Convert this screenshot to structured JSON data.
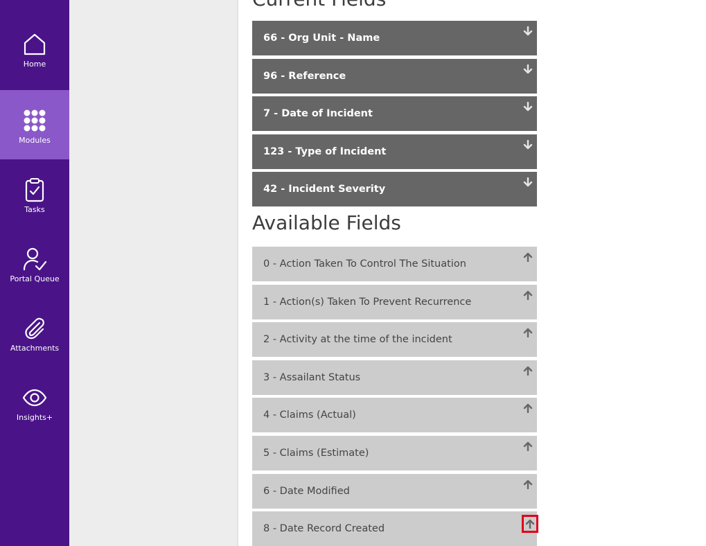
{
  "sidebar": {
    "items": [
      {
        "label": "Home",
        "icon": "home-icon",
        "active": false
      },
      {
        "label": "Modules",
        "icon": "grid-dots-icon",
        "active": true
      },
      {
        "label": "Tasks",
        "icon": "clipboard-check-icon",
        "active": false
      },
      {
        "label": "Portal Queue",
        "icon": "user-check-icon",
        "active": false
      },
      {
        "label": "Attachments",
        "icon": "paperclip-icon",
        "active": false
      },
      {
        "label": "Insights+",
        "icon": "eye-icon",
        "active": false
      }
    ],
    "colors": {
      "background": "#4a1488",
      "active": "#8a58c8"
    }
  },
  "main": {
    "current_heading": "Current Fields",
    "current_fields": [
      {
        "label": "66 - Org Unit - Name",
        "action_icon": "arrow-down-icon"
      },
      {
        "label": "96 - Reference",
        "action_icon": "arrow-down-icon"
      },
      {
        "label": "7 - Date of Incident",
        "action_icon": "arrow-down-icon"
      },
      {
        "label": "123 - Type of Incident",
        "action_icon": "arrow-down-icon"
      },
      {
        "label": "42 - Incident Severity",
        "action_icon": "arrow-down-icon"
      }
    ],
    "available_heading": "Available Fields",
    "available_fields": [
      {
        "label": "0 - Action Taken To Control The Situation",
        "action_icon": "arrow-up-icon"
      },
      {
        "label": "1 - Action(s) Taken To Prevent Recurrence",
        "action_icon": "arrow-up-icon"
      },
      {
        "label": "2 - Activity at the time of the incident",
        "action_icon": "arrow-up-icon"
      },
      {
        "label": "3 - Assailant Status",
        "action_icon": "arrow-up-icon"
      },
      {
        "label": "4 - Claims (Actual)",
        "action_icon": "arrow-up-icon"
      },
      {
        "label": "5 - Claims (Estimate)",
        "action_icon": "arrow-up-icon"
      },
      {
        "label": "6 - Date Modified",
        "action_icon": "arrow-up-icon"
      },
      {
        "label": "8 - Date Record Created",
        "action_icon": "arrow-up-icon",
        "highlighted": true
      }
    ],
    "colors": {
      "current_row": "#666666",
      "available_row": "#cccccc",
      "highlight": "#e0001a"
    }
  }
}
